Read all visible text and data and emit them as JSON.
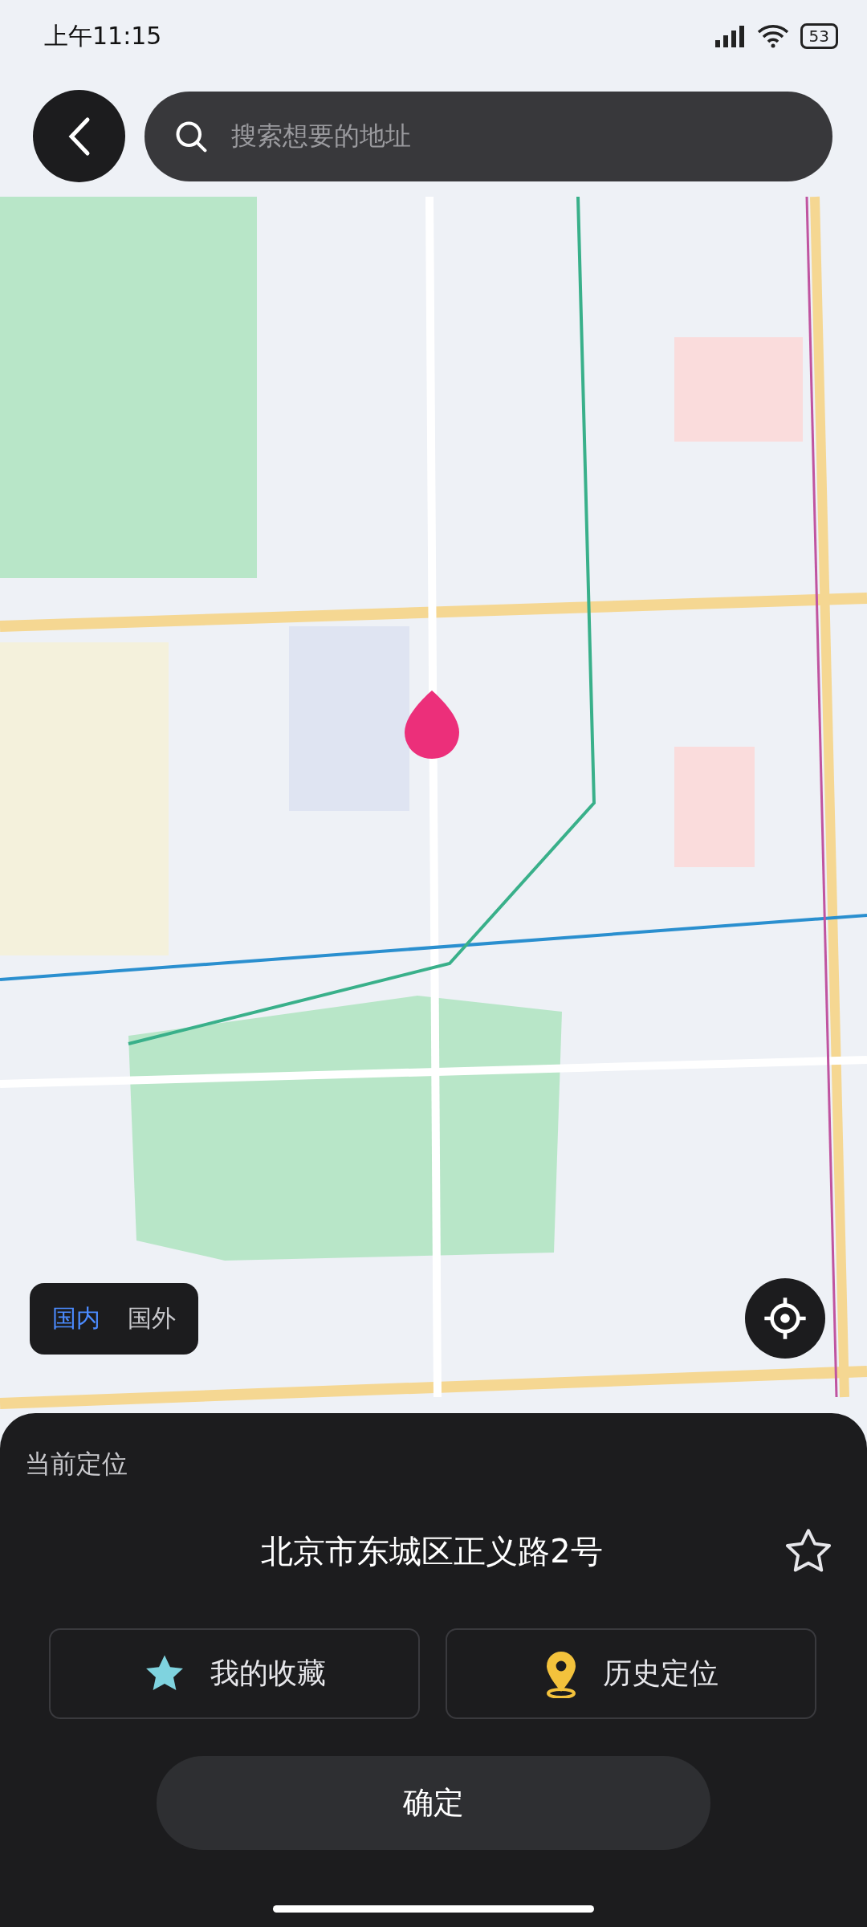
{
  "status_bar": {
    "time": "上午11:15",
    "battery": "53"
  },
  "search": {
    "placeholder": "搜索想要的地址"
  },
  "region_toggle": [
    {
      "label": "国内",
      "selected": true
    },
    {
      "label": "国外",
      "selected": false
    }
  ],
  "panel": {
    "title": "当前定位",
    "address": "北京市东城区正义路2号",
    "favorited": false,
    "shortcuts": [
      {
        "kind": "favorites",
        "label": "我的收藏"
      },
      {
        "kind": "history",
        "label": "历史定位"
      }
    ],
    "confirm": "确定"
  }
}
